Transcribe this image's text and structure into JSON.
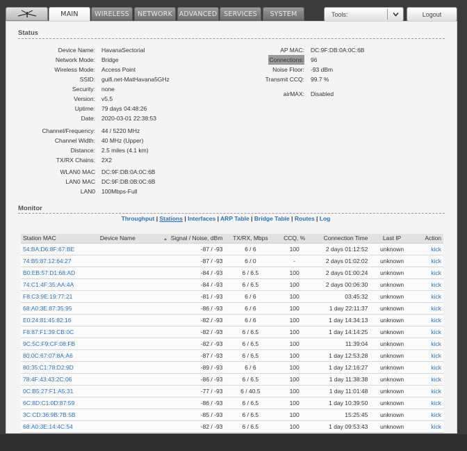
{
  "nav": {
    "tabs": [
      {
        "label": "MAIN",
        "active": true
      },
      {
        "label": "WIRELESS",
        "active": false
      },
      {
        "label": "NETWORK",
        "active": false
      },
      {
        "label": "ADVANCED",
        "active": false
      },
      {
        "label": "SERVICES",
        "active": false
      },
      {
        "label": "SYSTEM",
        "active": false
      }
    ],
    "tools_label": "Tools:",
    "logout_label": "Logout",
    "logo_icon": "ubiquiti-logo-icon"
  },
  "status": {
    "title": "Status",
    "left_group1": [
      {
        "label": "Device Name:",
        "value": "HavanaSectorial"
      },
      {
        "label": "Network Mode:",
        "value": "Bridge"
      },
      {
        "label": "Wireless Mode:",
        "value": "Access Point"
      },
      {
        "label": "SSID:",
        "value": "guifi.net-MatHavana5GHz"
      },
      {
        "label": "Security:",
        "value": "none"
      },
      {
        "label": "Version:",
        "value": "v5.5"
      },
      {
        "label": "Uptime:",
        "value": "79 days 04:48:26"
      },
      {
        "label": "Date:",
        "value": "2020-03-01 22:38:53"
      }
    ],
    "left_group2": [
      {
        "label": "Channel/Frequency:",
        "value": "44 / 5220 MHz"
      },
      {
        "label": "Channel Width:",
        "value": "40 MHz (Upper)"
      },
      {
        "label": "Distance:",
        "value": "2.5 miles (4.1 km)"
      },
      {
        "label": "TX/RX Chains:",
        "value": "2X2"
      }
    ],
    "left_group3": [
      {
        "label": "WLAN0 MAC",
        "value": "DC:9F:DB:0A:0C:6B"
      },
      {
        "label": "LAN0 MAC",
        "value": "DC:9F:DB:0B:0C:6B"
      },
      {
        "label": "LAN0",
        "value": "100Mbps-Full"
      }
    ],
    "right_group1": [
      {
        "label": "AP MAC:",
        "value": "DC:9F:DB:0A:0C:6B"
      },
      {
        "label": "Connections:",
        "value": "96"
      },
      {
        "label": "Noise Floor:",
        "value": "-93 dBm"
      },
      {
        "label": "Transmit CCQ:",
        "value": "99.7 %"
      }
    ],
    "right_group2": [
      {
        "label": "airMAX:",
        "value": "Disabled"
      }
    ]
  },
  "monitor": {
    "title": "Monitor",
    "links": [
      "Throughput",
      "Stations",
      "Interfaces",
      "ARP Table",
      "Bridge Table",
      "Routes",
      "Log"
    ],
    "active_link": "Stations",
    "columns": [
      "Station MAC",
      "Device Name",
      "Signal / Noise, dBm",
      "TX/RX, Mbps",
      "CCQ, %",
      "Connection Time",
      "Last IP",
      "Action"
    ],
    "rows": [
      [
        "54:BA:D6:8F:67:BE",
        "",
        "-87 / -93",
        "6 / 6",
        "100",
        "2 days 01:12:52",
        "unknown",
        "kick"
      ],
      [
        "74:B5:87:12:64:27",
        "",
        "-87 / -93",
        "6 / 0",
        "-",
        "2 days 01:02:02",
        "unknown",
        "kick"
      ],
      [
        "B0:EB:57:D1:68:AD",
        "",
        "-84 / -93",
        "6 / 6.5",
        "100",
        "2 days 01:00:24",
        "unknown",
        "kick"
      ],
      [
        "74:C1:4F:35:AA:4A",
        "",
        "-84 / -93",
        "6 / 6.5",
        "100",
        "2 days 00:06:30",
        "unknown",
        "kick"
      ],
      [
        "F8:C3:9E:19:77:21",
        "",
        "-81 / -93",
        "6 / 6",
        "100",
        "03:45:32",
        "unknown",
        "kick"
      ],
      [
        "68:A0:3E:87:35:95",
        "",
        "-86 / -93",
        "6 / 6",
        "100",
        "1 day 22:11:37",
        "unknown",
        "kick"
      ],
      [
        "E0:24:81:45:82:16",
        "",
        "-82 / -93",
        "6 / 6",
        "100",
        "1 day 14:34:13",
        "unknown",
        "kick"
      ],
      [
        "F8:87:F1:39:CB:0C",
        "",
        "-82 / -93",
        "6 / 6.5",
        "100",
        "1 day 14:14:25",
        "unknown",
        "kick"
      ],
      [
        "9C:5C:F9:CF:08:FB",
        "",
        "-82 / -93",
        "6 / 6.5",
        "100",
        "11:39:04",
        "unknown",
        "kick"
      ],
      [
        "80:0C:67:07:8A:A6",
        "",
        "-87 / -93",
        "6 / 6.5",
        "100",
        "1 day 12:53:28",
        "unknown",
        "kick"
      ],
      [
        "80:35:C1:78:D2:9D",
        "",
        "-89 / -93",
        "6 / 6",
        "100",
        "1 day 12:16:27",
        "unknown",
        "kick"
      ],
      [
        "78:4F:43:43:2C:06",
        "",
        "-86 / -93",
        "6 / 6.5",
        "100",
        "1 day 11:38:38",
        "unknown",
        "kick"
      ],
      [
        "0C:B5:27:F1:A5:31",
        "",
        "-77 / -93",
        "6 / 40.5",
        "100",
        "1 day 11:01:48",
        "unknown",
        "kick"
      ],
      [
        "6C:8D:C1:0D:87:59",
        "",
        "-86 / -93",
        "6 / 6.5",
        "100",
        "1 day 10:39:50",
        "unknown",
        "kick"
      ],
      [
        "3C:CD:36:9B:7B:5B",
        "",
        "-85 / -93",
        "6 / 6.5",
        "100",
        "15:25:45",
        "unknown",
        "kick"
      ],
      [
        "68:A0:3E:14:4C:54",
        "",
        "-82 / -93",
        "6 / 6.5",
        "100",
        "1 day 09:53:43",
        "unknown",
        "kick"
      ]
    ]
  }
}
